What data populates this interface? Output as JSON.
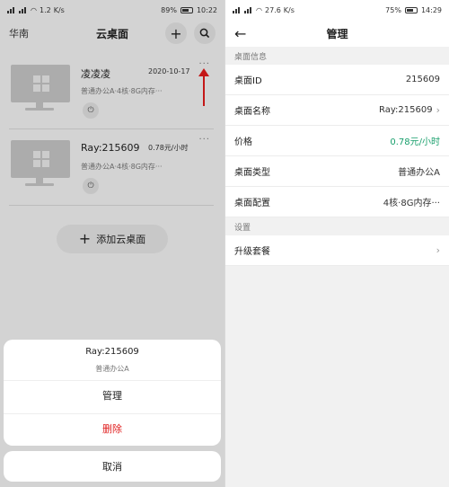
{
  "left": {
    "status": {
      "network_speed": "1.2",
      "speed_unit": "K/s",
      "battery": "89%",
      "time": "10:22"
    },
    "header": {
      "region": "华南",
      "title": "云桌面",
      "add_icon": "plus-icon",
      "search_icon": "search-icon"
    },
    "desktops": [
      {
        "name": "凌凌凌",
        "meta": "2020-10-17",
        "spec": "普通办公A·4核·8G内存···"
      },
      {
        "name": "Ray:215609",
        "meta": "0.78元/小时",
        "spec": "普通办公A·4核·8G内存···"
      }
    ],
    "add_button": "添加云桌面",
    "action_sheet": {
      "title": "Ray:215609",
      "subtitle": "普通办公A",
      "manage": "管理",
      "delete": "删除",
      "cancel": "取消"
    }
  },
  "right": {
    "status": {
      "network_speed": "27.6",
      "speed_unit": "K/s",
      "battery": "75%",
      "time": "14:29"
    },
    "header": {
      "title": "管理"
    },
    "section_info": "桌面信息",
    "rows": [
      {
        "label": "桌面ID",
        "value": "215609"
      },
      {
        "label": "桌面名称",
        "value": "Ray:215609"
      },
      {
        "label": "价格",
        "value": "0.78元/小时"
      },
      {
        "label": "桌面类型",
        "value": "普通办公A"
      },
      {
        "label": "桌面配置",
        "value": "4核·8G内存···"
      }
    ],
    "section_settings": "设置",
    "upgrade": "升级套餐"
  },
  "colors": {
    "price_green": "#1aa06d",
    "delete_red": "#e02020",
    "arrow_red": "#e01b1b"
  }
}
